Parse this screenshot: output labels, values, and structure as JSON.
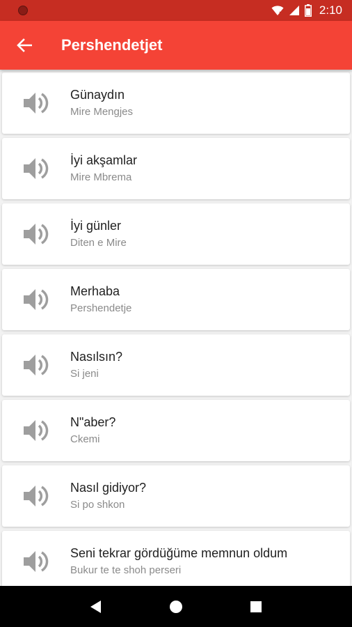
{
  "status_bar": {
    "time": "2:10"
  },
  "app_bar": {
    "title": "Pershendetjet",
    "back_icon": "arrow-left-icon"
  },
  "phrases": [
    {
      "phrase": "Günaydın",
      "translation": "Mire Mengjes"
    },
    {
      "phrase": "İyi akşamlar",
      "translation": "Mire Mbrema"
    },
    {
      "phrase": "İyi günler",
      "translation": "Diten e Mire"
    },
    {
      "phrase": "Merhaba",
      "translation": "Pershendetje"
    },
    {
      "phrase": "Nasılsın?",
      "translation": "Si jeni"
    },
    {
      "phrase": "N\"aber?",
      "translation": "Ckemi"
    },
    {
      "phrase": "Nasıl gidiyor?",
      "translation": "Si po shkon"
    },
    {
      "phrase": "Seni tekrar gördüğüme memnun oldum",
      "translation": "Bukur te te shoh perseri"
    }
  ],
  "colors": {
    "app_bar": "#f44336",
    "status_bar": "#c62d22",
    "speaker_icon": "#9e9e9e"
  }
}
